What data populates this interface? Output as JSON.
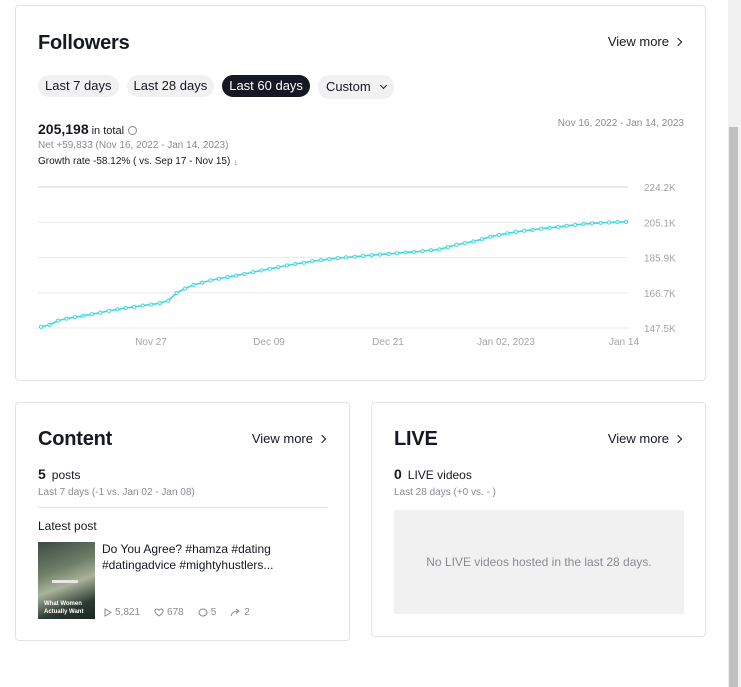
{
  "followers": {
    "title": "Followers",
    "view_more": "View more",
    "chips": [
      "Last 7 days",
      "Last 28 days",
      "Last 60 days",
      "Custom"
    ],
    "active_chip": "Last 60 days",
    "total": "205,198",
    "total_label": "in total",
    "net": "Net +59,833 (Nov 16, 2022 - Jan 14, 2023)",
    "growth": "Growth rate -58.12% ( vs. Sep 17 - Nov 15)",
    "date_range": "Nov 16, 2022 - Jan 14, 2023"
  },
  "chart_data": {
    "type": "line",
    "color": "#3fd8e0",
    "x_ticks": [
      "Nov 27",
      "Dec 09",
      "Dec 21",
      "Jan 02, 2023",
      "Jan 14"
    ],
    "y_ticks": [
      "224.2K",
      "205.1K",
      "185.9K",
      "166.7K",
      "147.5K"
    ],
    "ylim": [
      147500,
      224200
    ],
    "series": [
      {
        "values": [
          148100,
          149200,
          151500,
          152600,
          153400,
          154200,
          155000,
          155800,
          156800,
          157600,
          158400,
          159000,
          159700,
          160300,
          161000,
          162400,
          166600,
          169000,
          170900,
          172200,
          173400,
          174300,
          175200,
          176000,
          176900,
          177900,
          178800,
          179700,
          180600,
          181500,
          182300,
          183000,
          183800,
          184400,
          185000,
          185500,
          185900,
          186300,
          186700,
          187100,
          187500,
          187800,
          188200,
          188600,
          188900,
          189300,
          189800,
          190300,
          191500,
          192800,
          193700,
          194600,
          195800,
          197100,
          198100,
          199000,
          199800,
          200400,
          200900,
          201500,
          202000,
          202500,
          203100,
          203600,
          204100,
          204400,
          204700,
          204900,
          205100,
          205198
        ]
      }
    ]
  },
  "content": {
    "title": "Content",
    "view_more": "View more",
    "count": "5",
    "count_label": "posts",
    "sub": "Last 7 days (-1 vs. Jan 02 - Jan 08)",
    "latest_label": "Latest post",
    "thumb_text": "What Women Actually Want",
    "post_title": "Do You Agree? #hamza #dating #datingadvice #mightyhustlers...",
    "views": "5,821",
    "likes": "678",
    "comments": "5",
    "shares": "2"
  },
  "live": {
    "title": "LIVE",
    "view_more": "View more",
    "count": "0",
    "count_label": "LIVE videos",
    "sub": "Last 28 days (+0 vs. - )",
    "empty": "No LIVE videos hosted in the last 28 days."
  }
}
